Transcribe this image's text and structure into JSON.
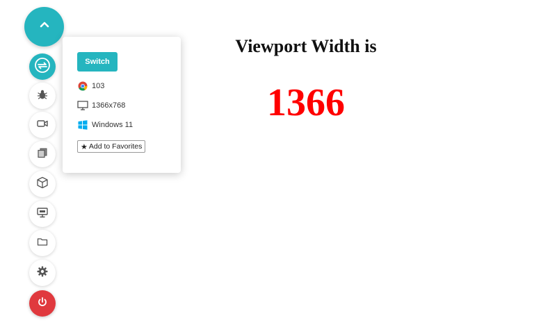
{
  "viewport": {
    "title": "Viewport Width is",
    "value": "1366"
  },
  "rail": {
    "items": [
      {
        "name": "collapse",
        "icon": "chevron-up-icon"
      },
      {
        "name": "switch-browser",
        "icon": "switch-arrows-icon",
        "active": true
      },
      {
        "name": "bug",
        "icon": "bug-icon"
      },
      {
        "name": "video",
        "icon": "video-camera-icon"
      },
      {
        "name": "screenshots",
        "icon": "gallery-icon"
      },
      {
        "name": "3d-box",
        "icon": "cube-icon"
      },
      {
        "name": "display",
        "icon": "monitor-icon"
      },
      {
        "name": "folder",
        "icon": "folder-icon"
      },
      {
        "name": "settings",
        "icon": "gear-icon"
      },
      {
        "name": "power",
        "icon": "power-icon"
      }
    ]
  },
  "popover": {
    "switch_label": "Switch",
    "browser_version": "103",
    "resolution": "1366x768",
    "os": "Windows 11",
    "favorite_label": "Add to Favorites"
  },
  "colors": {
    "accent": "#25b5bf",
    "danger": "#e0393e",
    "value_red": "#ff0000"
  }
}
